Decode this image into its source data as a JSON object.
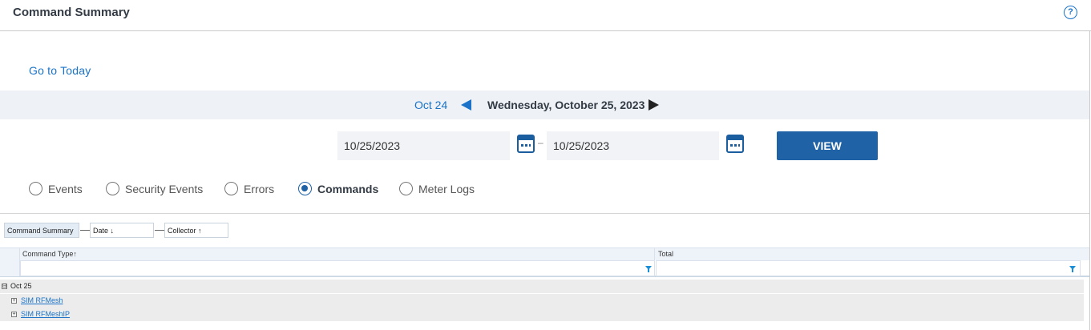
{
  "header": {
    "title": "Command Summary",
    "help_label": "?"
  },
  "navigation": {
    "go_to_today": "Go to Today",
    "prev_day_label": "Oct 24",
    "current_date": "Wednesday, October 25, 2023"
  },
  "date_range": {
    "from_value": "10/25/2023",
    "to_value": "10/25/2023",
    "separator": "–",
    "view_label": "VIEW"
  },
  "report_types": [
    {
      "label": "Events",
      "selected": false
    },
    {
      "label": "Security Events",
      "selected": false
    },
    {
      "label": "Errors",
      "selected": false
    },
    {
      "label": "Commands",
      "selected": true
    },
    {
      "label": "Meter Logs",
      "selected": false
    }
  ],
  "grouping": {
    "chips": [
      "Command Summary",
      "Date ↓",
      "Collector ↑"
    ]
  },
  "grid": {
    "columns": [
      "Command Type↑",
      "Total"
    ],
    "group_row": {
      "toggle": "⊟",
      "label": "Oct 25"
    },
    "sub_rows": [
      {
        "toggle": "+",
        "label": "SIM RFMesh"
      },
      {
        "toggle": "+",
        "label": "SIM RFMeshIP"
      }
    ]
  },
  "colors": {
    "accent_blue": "#1a73c8",
    "button_blue": "#1f62a5",
    "date_bar_bg": "#eef2f6"
  }
}
